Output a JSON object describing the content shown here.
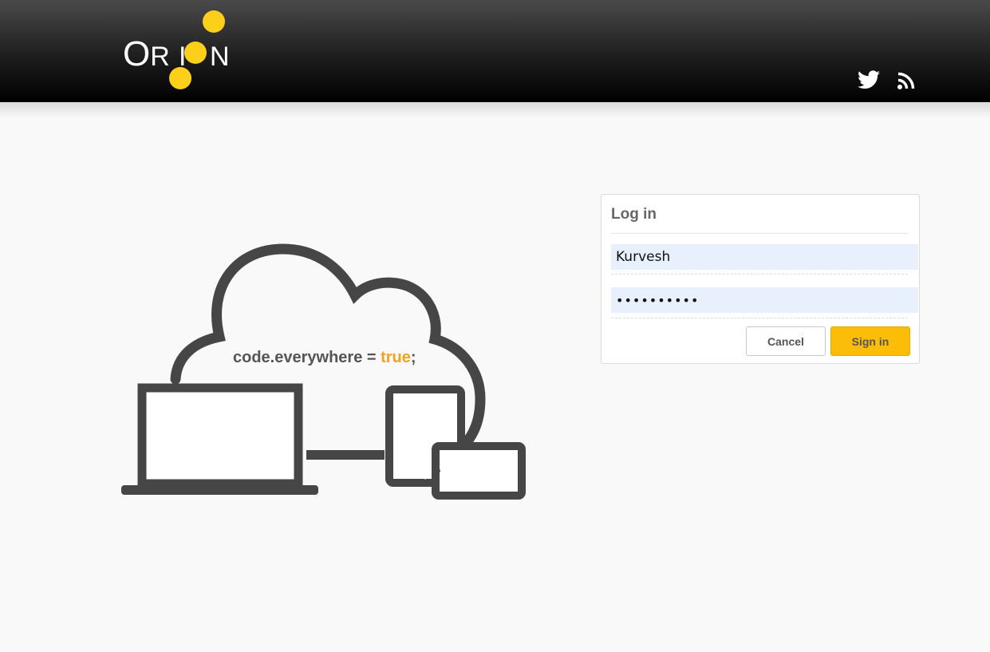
{
  "brand": {
    "logo_text": "ORION",
    "accent_color": "#fbcf1a"
  },
  "header": {
    "icons": [
      {
        "name": "twitter-icon"
      },
      {
        "name": "rss-icon"
      }
    ]
  },
  "illustration": {
    "tagline_prefix": "code.everywhere = ",
    "tagline_highlight": "true",
    "tagline_suffix": ";",
    "highlight_color": "#f5a11f"
  },
  "login": {
    "title": "Log in",
    "username_value": "Kurvesh",
    "password_value": "••••••••••",
    "cancel_label": "Cancel",
    "signin_label": "Sign in",
    "signin_color": "#fbbd08"
  }
}
